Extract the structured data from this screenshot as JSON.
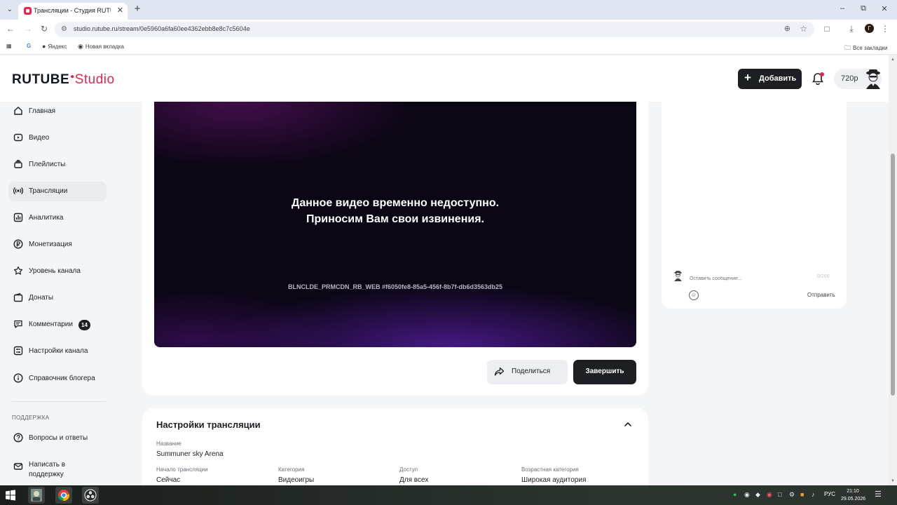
{
  "browser": {
    "tab_title": "Трансляции - Студия RUTUBE",
    "url": "studio.rutube.ru/stream/0e5960a6fa60ee4362ebb8e8c7c5604e",
    "bookmarks": [
      {
        "label": "",
        "icon": "google-icon"
      },
      {
        "label": "Яндекс",
        "icon": "yandex-icon"
      },
      {
        "label": "Новая вкладка",
        "icon": "chrome-icon"
      }
    ],
    "all_bookmarks": "Все закладки",
    "profile_initial": "Г"
  },
  "header": {
    "logo_main": "RUTUBE",
    "logo_sub": "Studio",
    "add_label": "Добавить",
    "quality_label": "720p"
  },
  "sidebar": {
    "items": [
      {
        "label": "Главная",
        "icon": "home-icon"
      },
      {
        "label": "Видео",
        "icon": "video-icon"
      },
      {
        "label": "Плейлисты",
        "icon": "playlist-icon"
      },
      {
        "label": "Трансляции",
        "icon": "broadcast-icon",
        "active": true
      },
      {
        "label": "Аналитика",
        "icon": "analytics-icon"
      },
      {
        "label": "Монетизация",
        "icon": "ruble-icon"
      },
      {
        "label": "Уровень канала",
        "icon": "star-icon"
      },
      {
        "label": "Донаты",
        "icon": "wallet-icon"
      },
      {
        "label": "Комментарии",
        "icon": "comment-icon",
        "count": "14"
      },
      {
        "label": "Настройки канала",
        "icon": "gear-icon"
      },
      {
        "label": "Справочник блогера",
        "icon": "info-icon"
      }
    ],
    "support_heading": "ПОДДЕРЖКА",
    "support_items": [
      {
        "label": "Вопросы и ответы",
        "icon": "question-icon"
      },
      {
        "label": "Написать в поддержку",
        "icon": "mail-icon"
      }
    ]
  },
  "player": {
    "message_line1": "Данное видео временно недоступно.",
    "message_line2": "Приносим Вам свои извинения.",
    "error_code": "BLNCLDE_PRMCDN_RB_WEB #f6050fe8-85a5-456f-8b7f-db6d3563db25",
    "share_label": "Поделиться",
    "finish_label": "Завершить"
  },
  "chat": {
    "placeholder": "Оставить сообщение...",
    "counter": "0/200",
    "send_label": "Отправить"
  },
  "settings": {
    "title": "Настройки трансляции",
    "name_label": "Название",
    "name_value": "Summuner sky Arena",
    "fields": [
      {
        "label": "Начало трансляции",
        "value": "Сейчас"
      },
      {
        "label": "Категория",
        "value": "Видеоигры"
      },
      {
        "label": "Доступ",
        "value": "Для всех"
      },
      {
        "label": "Возрастная категория",
        "value": "Широкая аудитория"
      }
    ]
  },
  "taskbar": {
    "lang": "РУС",
    "time": "21:10",
    "date": "29.05.2026"
  },
  "colors": {
    "brand": "#e6254a",
    "dark_button": "#1d1f24",
    "page_bg": "#f4f5f7"
  }
}
